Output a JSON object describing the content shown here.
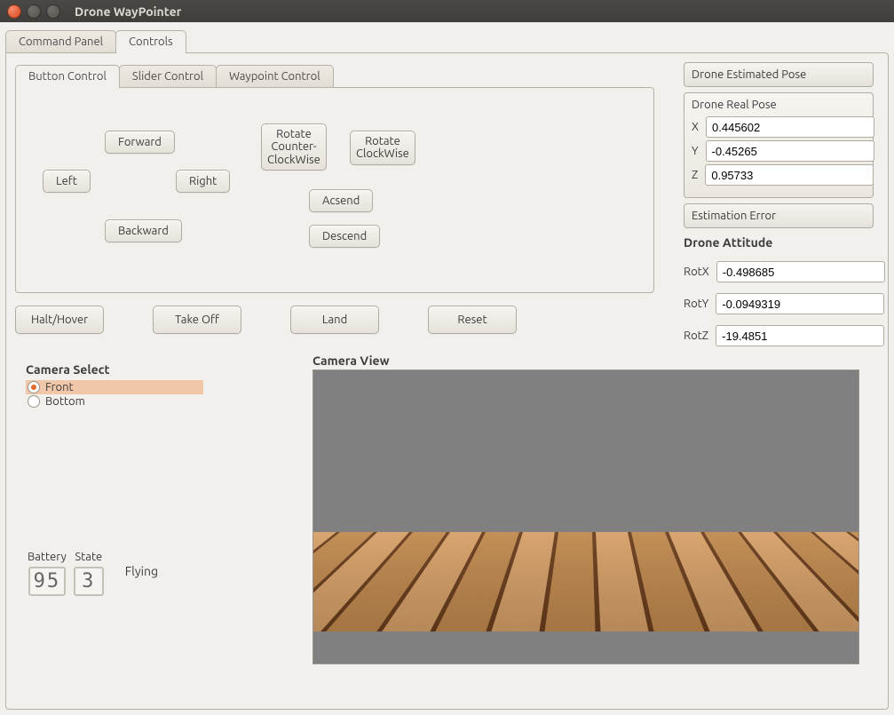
{
  "window": {
    "title": "Drone WayPointer"
  },
  "tabs": {
    "outer": [
      {
        "label": "Command Panel"
      },
      {
        "label": "Controls"
      }
    ],
    "outer_active": 1,
    "inner": [
      {
        "label": "Button Control"
      },
      {
        "label": "Slider Control"
      },
      {
        "label": "Waypoint Control"
      }
    ],
    "inner_active": 0
  },
  "button_control": {
    "forward": "Forward",
    "backward": "Backward",
    "left": "Left",
    "right": "Right",
    "rotate_ccw": "Rotate\nCounter-\nClockWise",
    "rotate_cw": "Rotate\nClockWise",
    "ascend": "Acsend",
    "descend": "Descend"
  },
  "actions": {
    "halt": "Halt/Hover",
    "takeoff": "Take Off",
    "land": "Land",
    "reset": "Reset"
  },
  "side": {
    "est_pose_btn": "Drone Estimated Pose",
    "real_pose_title": "Drone Real Pose",
    "x_label": "X",
    "y_label": "Y",
    "z_label": "Z",
    "x": "0.445602",
    "y": "-0.45265",
    "z": "0.95733",
    "est_error_btn": "Estimation Error",
    "attitude_title": "Drone Attitude",
    "rotx_label": "RotX",
    "roty_label": "RotY",
    "rotz_label": "RotZ",
    "rotx": "-0.498685",
    "roty": "-0.0949319",
    "rotz": "-19.4851"
  },
  "camera_select": {
    "heading": "Camera Select",
    "front": "Front",
    "bottom": "Bottom",
    "selected": "front"
  },
  "status": {
    "battery_label": "Battery",
    "state_label": "State",
    "battery": "95",
    "state_code": "3",
    "state_text": "Flying"
  },
  "camera_view": {
    "heading": "Camera View"
  }
}
